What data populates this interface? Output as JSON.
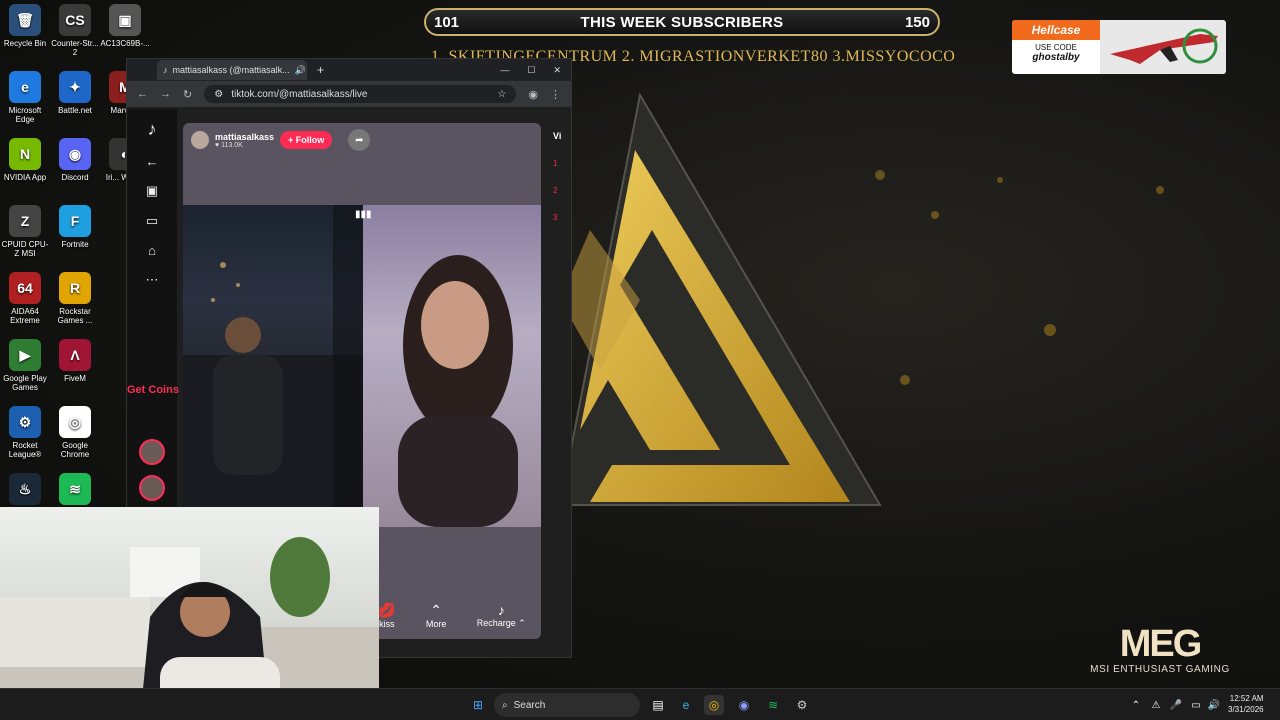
{
  "desktop": {
    "icons": [
      {
        "label": "Recycle Bin",
        "symbol": "🗑"
      },
      {
        "label": "Counter-Str... 2",
        "symbol": "CS"
      },
      {
        "label": "AC13C69B-...",
        "symbol": "▣"
      },
      {
        "label": "Microsoft Edge",
        "symbol": "e"
      },
      {
        "label": "Battle.net",
        "symbol": "✦"
      },
      {
        "label": "Marve...",
        "symbol": "M"
      },
      {
        "label": "NVIDIA App",
        "symbol": "N"
      },
      {
        "label": "Discord",
        "symbol": "◉"
      },
      {
        "label": "Iri... Web...",
        "symbol": "◐"
      },
      {
        "label": "CPUID CPU-Z MSI",
        "symbol": "Z"
      },
      {
        "label": "Fortnite",
        "symbol": "F"
      },
      {
        "label": "AIDA64 Extreme",
        "symbol": "64"
      },
      {
        "label": "Rockstar Games ...",
        "symbol": "R"
      },
      {
        "label": "Google Play Games",
        "symbol": "▶"
      },
      {
        "label": "FiveM",
        "symbol": "Λ"
      },
      {
        "label": "Rocket League®",
        "symbol": "⚙"
      },
      {
        "label": "Google Chrome",
        "symbol": "◎"
      },
      {
        "label": "",
        "symbol": "♨"
      },
      {
        "label": "",
        "symbol": "≋"
      }
    ]
  },
  "overlay": {
    "sub_count_left": "101",
    "sub_title": "THIS WEEK SUBSCRIBERS",
    "sub_count_right": "150",
    "top_subs": "1. SKIFTINGECENTRUM  2. MIGRASTIONVERKET80 3.MISSYOCOCO",
    "sponsor_brand": "Hellcase",
    "sponsor_use_code": "USE CODE",
    "sponsor_code": "ghostalby"
  },
  "browser": {
    "tab_title": "mattiasalkass (@mattiasalk...",
    "url": "tiktok.com/@mattiasalkass/live",
    "new_tab_symbol": "+",
    "controls": {
      "min": "—",
      "max": "☐",
      "close": "✕"
    }
  },
  "tiktok": {
    "get_coins": "Get Coins",
    "host_name": "mattiasalkass",
    "host_likes": "♥ 113.0K",
    "follow_label": "+ Follow",
    "bottom": [
      {
        "label": "kiss",
        "symbol": "💋"
      },
      {
        "label": "More",
        "symbol": "⌃"
      },
      {
        "label": "Recharge ⌃",
        "symbol": "♪"
      }
    ],
    "rail_label": "Vi",
    "rail_ranks": [
      "1",
      "2",
      "3"
    ]
  },
  "branding": {
    "meg_mark": "MEG",
    "meg_sub": "MSI ENTHUSIAST GAMING"
  },
  "taskbar": {
    "search_label": "Search",
    "time": "12:52 AM",
    "date": "3/31/2026"
  },
  "colors": {
    "tiktok_red": "#fe2c55",
    "gold": "#e0b85a",
    "hellcase_orange": "#f26a1b"
  }
}
